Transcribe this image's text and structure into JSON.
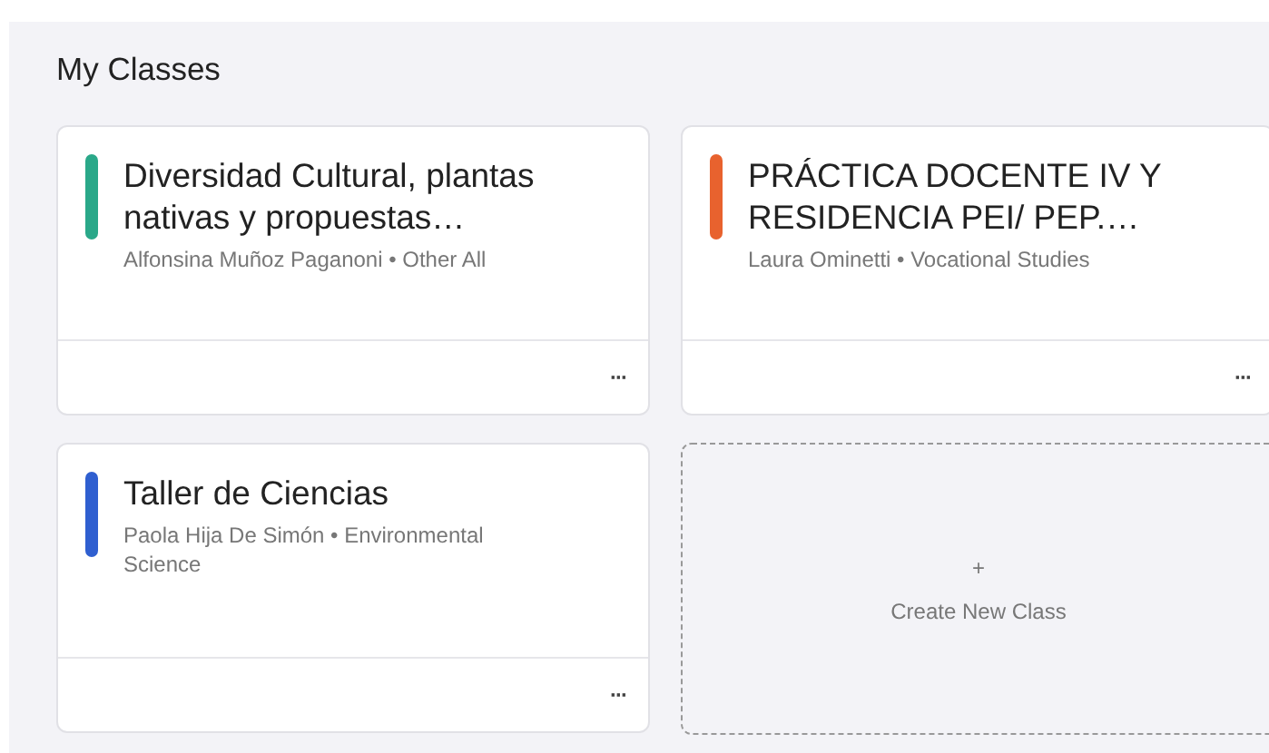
{
  "heading": "My Classes",
  "classes": [
    {
      "title": "Diversidad Cultural, plantas nativas y propuestas…",
      "subtitle": "Alfonsina Muñoz Paganoni • Other All",
      "color": "#2aa889",
      "menu": "···"
    },
    {
      "title": "PRÁCTICA DOCENTE IV Y RESIDENCIA PEI/ PEP.…",
      "subtitle": "Laura Ominetti • Vocational Studies",
      "color": "#e8622e",
      "menu": "···"
    },
    {
      "title": "Taller de Ciencias",
      "subtitle": "Paola Hija De Simón • Environmental Science",
      "color": "#2f5fd0",
      "menu": "···"
    }
  ],
  "create": {
    "icon": "+",
    "label": "Create New Class"
  }
}
